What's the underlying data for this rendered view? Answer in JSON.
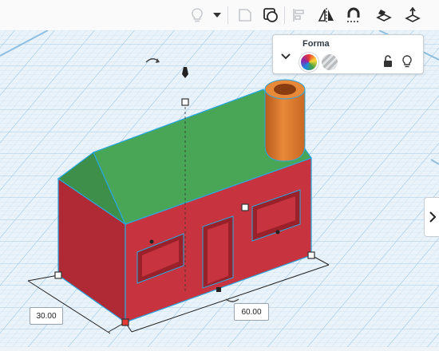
{
  "toolbar": {
    "buttons": [
      {
        "name": "hint-bulb-icon",
        "enabled": false
      },
      {
        "name": "dropdown-chevron-icon",
        "enabled": true
      },
      {
        "name": "note-shape-icon",
        "enabled": false
      },
      {
        "name": "view-shapes-icon",
        "enabled": true
      },
      {
        "name": "align-icon",
        "enabled": false
      },
      {
        "name": "mirror-icon",
        "enabled": true
      },
      {
        "name": "cruise-magnet-icon",
        "enabled": true
      },
      {
        "name": "workplane-icon",
        "enabled": true
      },
      {
        "name": "ruler-icon",
        "enabled": true
      }
    ]
  },
  "shape_panel": {
    "title": "Forma",
    "color_swatch": "multicolor",
    "hole_swatch": "hole"
  },
  "dimensions": {
    "width": "30.00",
    "length": "60.00"
  },
  "colors": {
    "walls": "#c7343f",
    "roof": "#4aa657",
    "chimney": "#e07a2f",
    "selection_outline": "#29a8e0",
    "grid": "#b9d6ea"
  }
}
